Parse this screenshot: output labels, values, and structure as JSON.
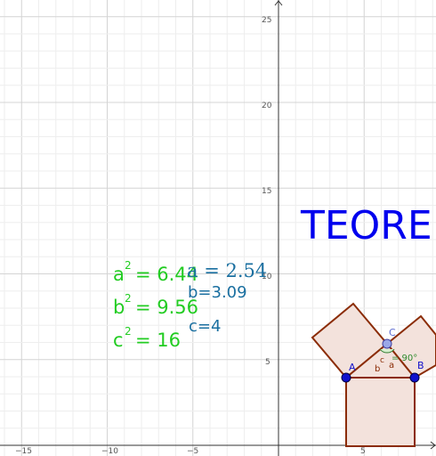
{
  "axes": {
    "x_ticks": [
      "−15",
      "−10",
      "−5",
      "5"
    ],
    "y_ticks": [
      "5",
      "10",
      "15",
      "20",
      "25"
    ]
  },
  "title_text": "TEORE",
  "points": {
    "A": "A",
    "B": "B",
    "C": "C"
  },
  "small_labels": {
    "a": "a",
    "b": "b",
    "c": "c",
    "angle": "= 90°"
  },
  "green_formulas": {
    "a_sq_base": "a",
    "a_sq_value": "= 6.44",
    "b_sq_base": "b",
    "b_sq_value": "= 9.56",
    "c_sq_base": "c",
    "c_sq_value": "= 16",
    "exponent": "2"
  },
  "side_lengths": {
    "a": "a = 2.54",
    "b": "b=3.09",
    "c": "c=4"
  },
  "colors": {
    "grid_minor": "#eeeeee",
    "grid_major": "#d4d4d4",
    "axis": "#333333",
    "green": "#22cc22",
    "teal": "#1a6fa0",
    "title": "#0000ee",
    "square_fill": "#f3e2dc",
    "square_stroke": "#8b2c06",
    "point": "#1010cc",
    "point_c": "#9aa8e8"
  }
}
